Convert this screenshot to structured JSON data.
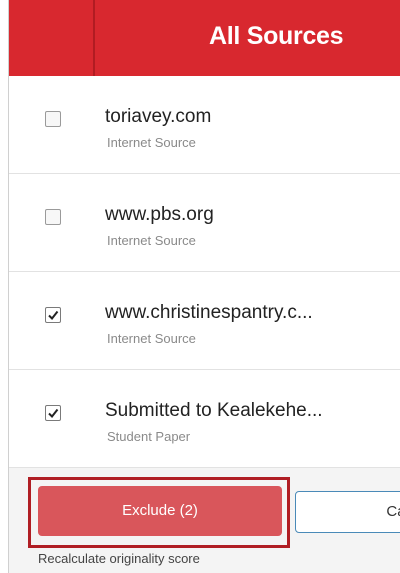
{
  "header": {
    "title": "All Sources"
  },
  "sources": [
    {
      "name": "toriavey.com",
      "type": "Internet Source",
      "checked": false
    },
    {
      "name": "www.pbs.org",
      "type": "Internet Source",
      "checked": false
    },
    {
      "name": "www.christinespantry.c...",
      "type": "Internet Source",
      "checked": true
    },
    {
      "name": "Submitted to Kealekehe...",
      "type": "Student Paper",
      "checked": true
    }
  ],
  "footer": {
    "exclude_label": "Exclude (2)",
    "cancel_label": "Ca",
    "recalc_text": "Recalculate originality score"
  },
  "colors": {
    "brand_red": "#d8282f",
    "exclude_button": "#d9565b",
    "highlight_border": "#b01e24"
  },
  "icons": {
    "checkbox_checked": "check-icon"
  }
}
